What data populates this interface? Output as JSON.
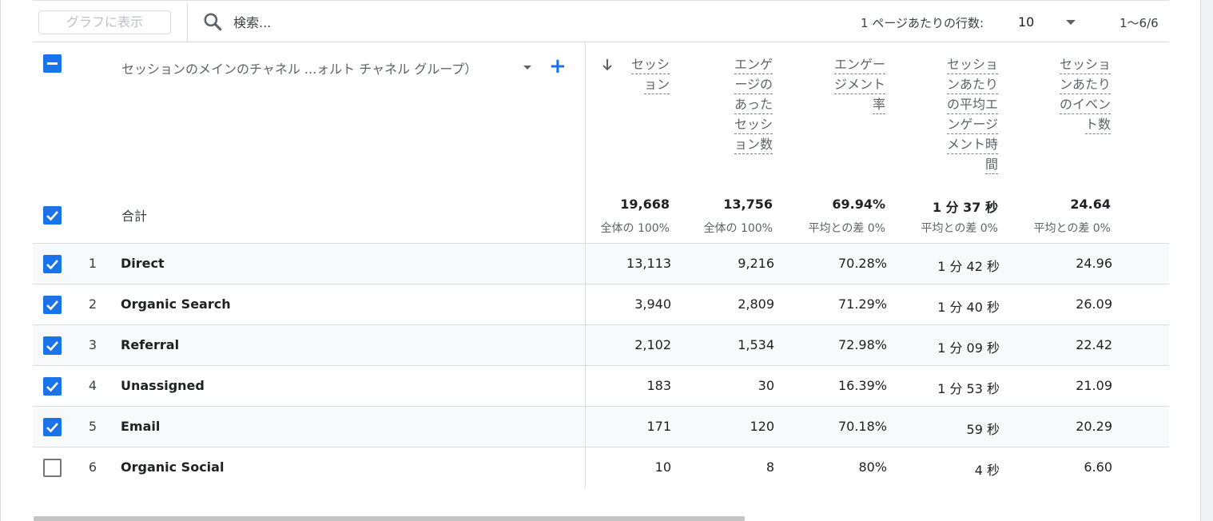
{
  "toolbar": {
    "graph_button": "グラフに表示",
    "search_placeholder": "検索...",
    "rows_per_page_label": "1 ページあたりの行数:",
    "rows_per_page_value": "10",
    "page_range": "1〜6/6",
    "icons": {
      "search": "search-icon",
      "caret": "chevron-down-icon"
    }
  },
  "header": {
    "dimension_label": "セッションのメインのチャネル ...ォルト チャネル グループ）",
    "add_icon": "plus-icon",
    "sort_icon": "arrow-down-icon",
    "metrics": [
      {
        "lines": [
          "セッシ",
          "ョン"
        ]
      },
      {
        "lines": [
          "エンゲ",
          "ージの",
          "あった",
          "セッシ",
          "ョン数"
        ]
      },
      {
        "lines": [
          "エンゲー",
          "ジメント",
          "率"
        ]
      },
      {
        "lines": [
          "セッショ",
          "ンあたり",
          "の平均エ",
          "ンゲージ",
          "メント時",
          "間"
        ]
      },
      {
        "lines": [
          "セッショ",
          "ンあたり",
          "のイベン",
          "ト数"
        ]
      }
    ]
  },
  "totals": {
    "label": "合計",
    "values": [
      "19,668",
      "13,756",
      "69.94%",
      "1 分 37 秒",
      "24.64"
    ],
    "subtexts": [
      "全体の 100%",
      "全体の 100%",
      "平均との差 0%",
      "平均との差 0%",
      "平均との差 0%"
    ]
  },
  "rows": [
    {
      "num": "1",
      "label": "Direct",
      "values": [
        "13,113",
        "9,216",
        "70.28%",
        "1 分 42 秒",
        "24.96"
      ],
      "checked": true
    },
    {
      "num": "2",
      "label": "Organic Search",
      "values": [
        "3,940",
        "2,809",
        "71.29%",
        "1 分 40 秒",
        "26.09"
      ],
      "checked": true
    },
    {
      "num": "3",
      "label": "Referral",
      "values": [
        "2,102",
        "1,534",
        "72.98%",
        "1 分 09 秒",
        "22.42"
      ],
      "checked": true
    },
    {
      "num": "4",
      "label": "Unassigned",
      "values": [
        "183",
        "30",
        "16.39%",
        "1 分 53 秒",
        "21.09"
      ],
      "checked": true
    },
    {
      "num": "5",
      "label": "Email",
      "values": [
        "171",
        "120",
        "70.18%",
        "59 秒",
        "20.29"
      ],
      "checked": true
    },
    {
      "num": "6",
      "label": "Organic Social",
      "values": [
        "10",
        "8",
        "80%",
        "4 秒",
        "6.60"
      ],
      "checked": false
    }
  ],
  "colors": {
    "accent": "#1a73e8",
    "border": "#dadce0",
    "text_muted": "#5f6368"
  }
}
